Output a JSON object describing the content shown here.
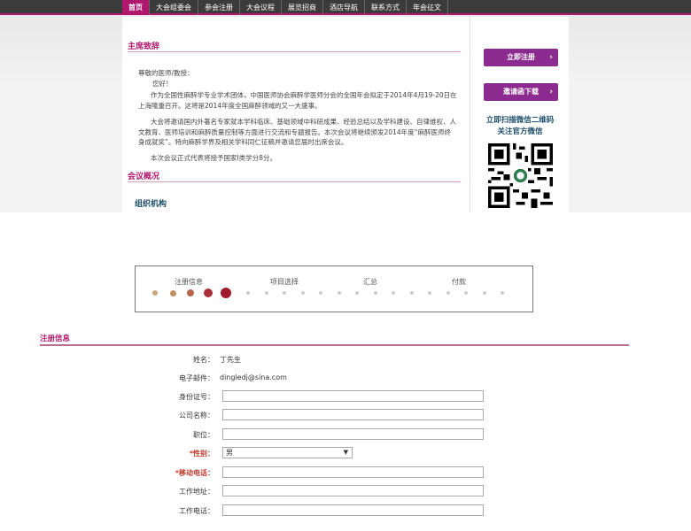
{
  "nav": {
    "items": [
      "首页",
      "大会组委会",
      "参会注册",
      "大会议程",
      "展览招商",
      "酒店导航",
      "联系方式",
      "年会征文"
    ]
  },
  "welcome": {
    "title": "主席致辞",
    "greeting": "尊敬的医师/教授：",
    "hello": "您好！",
    "p1": "作为全国性麻醉学专业学术团体，中国医师协会麻醉学医师分会的全国年会拟定于2014年4月19-20日在上海隆重召开。这将是2014年度全国麻醉领域的又一大盛事。",
    "p2": "大会将邀请国内外著名专家就本学科临床、基础领域中科研成果、经验总结以及学科建设、自律维权、人文教育、医师培训和麻醉质量控制等方面进行交流和专题报告。本次会议将继续颁发2014年度“麻醉医师终身成就奖”。特向麻醉学界及相关学科同仁征稿并邀请您届时出席会议。",
    "p3": "本次会议正式代表将授予国家Ⅰ类学分8分。"
  },
  "overview": {
    "title": "会议概况",
    "org_title": "组织机构"
  },
  "sidebar": {
    "register_btn": "立即注册",
    "invite_btn": "邀请函下载",
    "wechat_line1": "立即扫描微信二维码",
    "wechat_line2": "关注官方微信",
    "chevron": "›"
  },
  "progress": {
    "steps": [
      "注册信息",
      "项目选择",
      "汇总",
      "付款"
    ],
    "active_color": "#9e1a2c",
    "inactive_color": "#cccccc"
  },
  "form": {
    "title": "注册信息",
    "fields": {
      "name_label": "姓名：",
      "name_value": "丁先生",
      "email_label": "电子邮件：",
      "email_value": "dingledj@sina.com",
      "id_label": "身份证号：",
      "company_label": "公司名称：",
      "position_label": "职位：",
      "gender_label": "*性别：",
      "gender_value": "男",
      "mobile_label": "*移动电话：",
      "work_address_label": "工作地址：",
      "work_phone_label": "工作电话："
    },
    "dropdown_arrow": "▼"
  },
  "colors": {
    "accent": "#b0186e",
    "nav_bg": "#3b3b3b",
    "button": "#8c2b8f"
  }
}
